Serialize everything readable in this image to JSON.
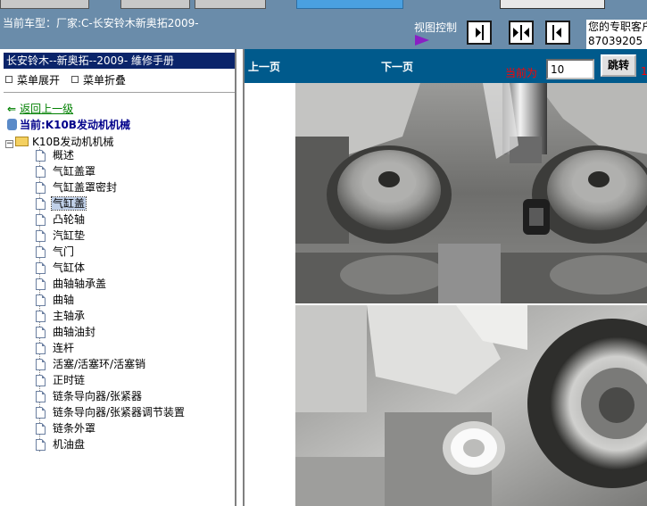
{
  "header": {
    "vehicle_info": "当前车型：厂家:C-长安铃木新奥拓2009-",
    "view_control_label": "视图控制",
    "contact_line1": "您的专职客户",
    "contact_line2": "87039205"
  },
  "sidebar": {
    "manual_title": "长安铃木--新奥拓--2009- 維修手册",
    "expand_menu": "菜单展开",
    "collapse_menu": "菜单折叠",
    "back_link": "返回上一级",
    "current_label": "当前:K10B发动机机械",
    "root_node": "K10B发动机机械",
    "items": [
      {
        "label": "概述"
      },
      {
        "label": "气缸盖罩"
      },
      {
        "label": "气缸盖罩密封"
      },
      {
        "label": "气缸盖"
      },
      {
        "label": "凸轮轴"
      },
      {
        "label": "汽缸垫"
      },
      {
        "label": "气门"
      },
      {
        "label": "气缸体"
      },
      {
        "label": "曲轴轴承盖"
      },
      {
        "label": "曲轴"
      },
      {
        "label": "主轴承"
      },
      {
        "label": "曲轴油封"
      },
      {
        "label": "连杆"
      },
      {
        "label": "活塞/活塞环/活塞销"
      },
      {
        "label": "正时链"
      },
      {
        "label": "链条导向器/张紧器"
      },
      {
        "label": "链条导向器/张紧器调节装置"
      },
      {
        "label": "链条外罩"
      },
      {
        "label": "机油盘"
      }
    ],
    "selected_index": 3
  },
  "content": {
    "prev_page": "上一页",
    "next_page": "下一页",
    "current_page_label": "当前为",
    "page_value": "10",
    "jump_button": "跳转",
    "page_total_partial": "10"
  },
  "colors": {
    "toolbar_bg": "#6a8caa",
    "nav_bg": "#005a8c",
    "title_bg": "#0a246a",
    "accent_red": "#ff0000"
  },
  "icons": {
    "back": "back-arrow-icon",
    "view_buttons": [
      "expand-right-icon",
      "split-view-icon",
      "collapse-left-icon"
    ]
  }
}
